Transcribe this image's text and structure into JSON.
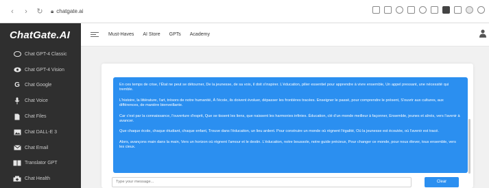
{
  "browser": {
    "url": "chatgate.ai",
    "nav": {
      "back": "‹",
      "forward": "›",
      "reload": "↻"
    }
  },
  "sidebar": {
    "brand": "ChatGate.AI",
    "items": [
      {
        "label": "Chat GPT-4 Classic",
        "icon": "chat-bubble-icon"
      },
      {
        "label": "Chat GPT-4 Vision",
        "icon": "eye-icon"
      },
      {
        "label": "Chat Google",
        "icon": "google-icon"
      },
      {
        "label": "Chat Voice",
        "icon": "microphone-icon"
      },
      {
        "label": "Chat Files",
        "icon": "file-icon"
      },
      {
        "label": "Chat DALL-E 3",
        "icon": "image-icon"
      },
      {
        "label": "Chat Email",
        "icon": "envelope-icon"
      },
      {
        "label": "Translator GPT",
        "icon": "translate-icon"
      },
      {
        "label": "Chat Health",
        "icon": "health-icon"
      }
    ]
  },
  "topnav": {
    "links": [
      "Must-Haves",
      "AI Store",
      "GPTs",
      "Academy"
    ]
  },
  "chat": {
    "paragraphs": [
      "En ces temps de crise, l'État ne peut se détourner, De la jeunesse, de sa voix, il doit s'inspirer. L'éducation, pilier essentiel pour apprendre à vivre ensemble, Un appel pressant, une nécessité qui tremble.",
      "L'histoire, la littérature, l'art, trésors de notre humanité, À l'école, ils doivent évoluer, dépasser les frontières tracées. Enseigner le passé, pour comprendre le présent, S'ouvrir aux cultures, aux différences, de manière bienveillante.",
      "Car c'est par la connaissance, l'ouverture d'esprit, Que se tissent les liens, que naissent les harmonies infinies. Éducation, clé d'un monde meilleur à façonner, Ensemble, jeunes et aînés, vers l'avenir à avancer.",
      "Que chaque école, chaque étudiant, chaque enfant, Trouve dans l'éducation, un lieu ardent. Pour construire un monde où règnent l'égalité, Où la jeunesse est écoutée, où l'avenir est tracé.",
      "Alors, avançons main dans la main, Vers un horizon où règnent l'amour et le destin. L'éducation, notre boussole, notre guide précieux, Pour changer ce monde, pour nous élever, tous ensemble, vers les cieux."
    ],
    "input_placeholder": "Type your message...",
    "clear_label": "Clear"
  },
  "colors": {
    "sidebar_bg": "#2f2f2f",
    "accent": "#2b8ff0"
  }
}
